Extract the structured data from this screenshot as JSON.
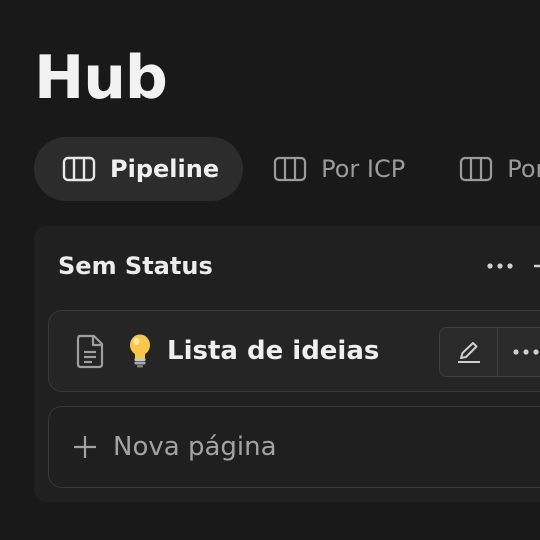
{
  "page": {
    "title": "Hub"
  },
  "tabs": [
    {
      "label": "Pipeline",
      "icon": "board-view-icon",
      "active": true
    },
    {
      "label": "Por ICP",
      "icon": "board-view-icon",
      "active": false
    },
    {
      "label": "Por",
      "icon": "board-view-icon",
      "active": false
    }
  ],
  "board": {
    "group": {
      "label": "Sem Status",
      "menu_icon": "more-icon",
      "add_icon": "plus-icon"
    },
    "card": {
      "icon": "document-icon",
      "emoji_icon": "lightbulb-icon",
      "title": "Lista de ideias",
      "edit_icon": "edit-icon",
      "more_icon": "more-icon"
    },
    "new_page": {
      "icon": "plus-icon",
      "label": "Nova página"
    }
  },
  "colors": {
    "background": "#191919",
    "active_tab": "#2c2c2c",
    "board": "#202020",
    "card": "#252525",
    "border": "#383838"
  }
}
